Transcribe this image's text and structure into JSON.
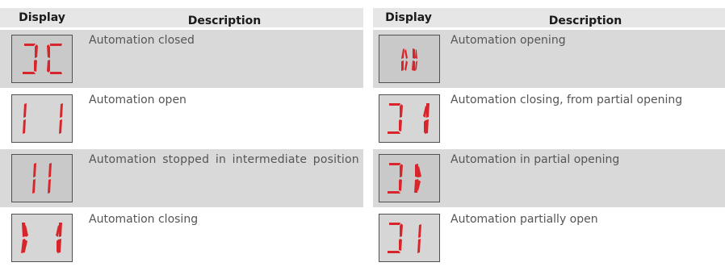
{
  "left_table": {
    "header": {
      "display": "Display",
      "description": "Description"
    },
    "rows": [
      {
        "description": "Automation closed",
        "display_icon": "display-closed-icon"
      },
      {
        "description": "Automation open",
        "display_icon": "display-open-icon"
      },
      {
        "description": "Automation stopped in intermediate position",
        "display_icon": "display-stopped-icon"
      },
      {
        "description": "Automation closing",
        "display_icon": "display-closing-icon"
      }
    ]
  },
  "right_table": {
    "header": {
      "display": "Display",
      "description": "Description"
    },
    "rows": [
      {
        "description": "Automation opening",
        "display_icon": "display-opening-icon"
      },
      {
        "description": "Automation closing, from partial opening",
        "display_icon": "display-closing-partial-icon"
      },
      {
        "description": "Automation in partial opening",
        "display_icon": "display-partial-opening-icon"
      },
      {
        "description": "Automation partially open",
        "display_icon": "display-partially-open-icon"
      }
    ]
  },
  "colors": {
    "segment": "#d6262b",
    "shaded_row": "#d9d9d9",
    "header_bg": "#e6e6e6"
  }
}
